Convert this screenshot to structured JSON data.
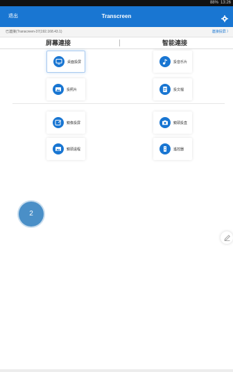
{
  "statusbar": {
    "battery": "88%",
    "time": "13:26"
  },
  "topbar": {
    "exit_label": "退出",
    "title": "Transcreen"
  },
  "connection": {
    "status_text": "已連接(Transcreen-37(192.168.43.1)",
    "help_link": "連接投屏 〉"
  },
  "tabs": [
    {
      "label": "屏幕連接"
    },
    {
      "label": "智能連接"
    }
  ],
  "tiles": [
    {
      "label": "桌面投屏",
      "icon": "monitor-icon",
      "selected": true
    },
    {
      "label": "投音乐片",
      "icon": "music-icon"
    },
    {
      "label": "投照片",
      "icon": "photo-icon"
    },
    {
      "label": "投文檔",
      "icon": "document-icon"
    },
    {
      "label": "鏡像投屏",
      "icon": "mirror-icon"
    },
    {
      "label": "鏡頭投直",
      "icon": "camera-icon"
    },
    {
      "label": "鏡頭遠程",
      "icon": "image-icon"
    },
    {
      "label": "遙控器",
      "icon": "remote-icon"
    }
  ],
  "step_badge": "2",
  "colors": {
    "primary": "#1976d2",
    "badge": "#4a8fc7"
  }
}
